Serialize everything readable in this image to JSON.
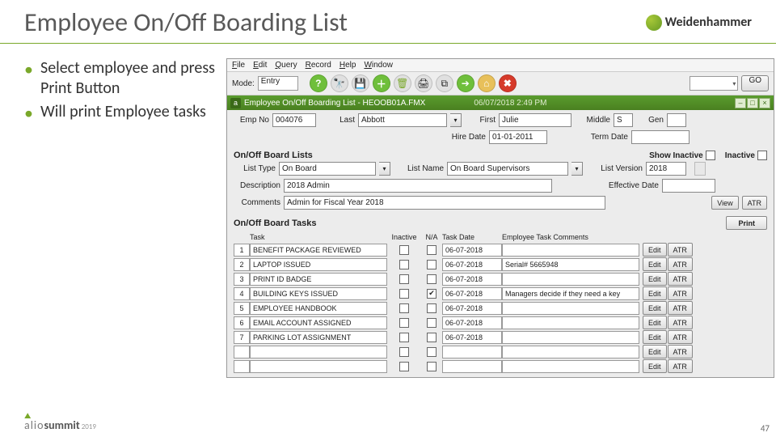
{
  "slide": {
    "title": "Employee On/Off Boarding List",
    "brand": "Weidenhammer",
    "page_number": "47",
    "footer_alio": "alio",
    "footer_summit": "summit",
    "footer_year": "2019"
  },
  "bullets": [
    "Select employee and press Print Button",
    "Will print Employee tasks"
  ],
  "app": {
    "menu": {
      "file": "File",
      "edit": "Edit",
      "query": "Query",
      "record": "Record",
      "help": "Help",
      "window": "Window"
    },
    "mode_label": "Mode:",
    "mode_value": "Entry",
    "go": "GO",
    "window_title": "Employee On/Off Boarding List - HEOOB01A.FMX",
    "window_date": "06/07/2018 2:49 PM",
    "emp": {
      "no_lbl": "Emp No",
      "no": "004076",
      "last_lbl": "Last",
      "last": "Abbott",
      "first_lbl": "First",
      "first": "Julie",
      "middle_lbl": "Middle",
      "middle": "S",
      "gen_lbl": "Gen",
      "hire_lbl": "Hire Date",
      "hire": "01-01-2011",
      "term_lbl": "Term Date",
      "term": ""
    },
    "lists_hdr": "On/Off Board Lists",
    "show_inactive_lbl": "Show Inactive",
    "inactive_lbl": "Inactive",
    "list": {
      "type_lbl": "List Type",
      "type": "On Board",
      "name_lbl": "List Name",
      "name": "On Board Supervisors",
      "version_lbl": "List Version",
      "version": "2018",
      "desc_lbl": "Description",
      "desc": "2018 Admin",
      "eff_lbl": "Effective Date",
      "eff": "",
      "comments_lbl": "Comments",
      "comments": "Admin for Fiscal Year 2018",
      "view_btn": "View",
      "atr_btn": "ATR"
    },
    "tasks_hdr": "On/Off Board Tasks",
    "print_btn": "Print",
    "cols": {
      "task": "Task",
      "inactive": "Inactive",
      "na": "N/A",
      "date": "Task Date",
      "comments": "Employee Task Comments"
    },
    "edit_btn": "Edit",
    "tasks": [
      {
        "n": "1",
        "task": "BENEFIT PACKAGE REVIEWED",
        "na": false,
        "date": "06-07-2018",
        "comments": ""
      },
      {
        "n": "2",
        "task": "LAPTOP ISSUED",
        "na": false,
        "date": "06-07-2018",
        "comments": "Serial# 5665948"
      },
      {
        "n": "3",
        "task": "PRINT ID BADGE",
        "na": false,
        "date": "06-07-2018",
        "comments": ""
      },
      {
        "n": "4",
        "task": "BUILDING KEYS ISSUED",
        "na": true,
        "date": "06-07-2018",
        "comments": "Managers decide if they need a key"
      },
      {
        "n": "5",
        "task": "EMPLOYEE HANDBOOK",
        "na": false,
        "date": "06-07-2018",
        "comments": ""
      },
      {
        "n": "6",
        "task": "EMAIL ACCOUNT ASSIGNED",
        "na": false,
        "date": "06-07-2018",
        "comments": ""
      },
      {
        "n": "7",
        "task": "PARKING LOT ASSIGNMENT",
        "na": false,
        "date": "06-07-2018",
        "comments": ""
      },
      {
        "n": "",
        "task": "",
        "na": false,
        "date": "",
        "comments": ""
      },
      {
        "n": "",
        "task": "",
        "na": false,
        "date": "",
        "comments": ""
      }
    ]
  }
}
